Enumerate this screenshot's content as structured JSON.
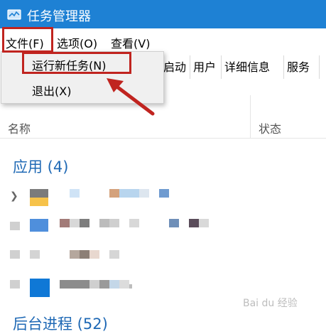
{
  "window": {
    "title": "任务管理器"
  },
  "menubar": {
    "file": "文件(F)",
    "options": "选项(O)",
    "view": "查看(V)"
  },
  "dropdown": {
    "items": [
      {
        "label": "运行新任务(N)"
      },
      {
        "label": "退出(X)"
      }
    ]
  },
  "tabs": [
    "启动",
    "用户",
    "详细信息",
    "服务"
  ],
  "table": {
    "columns": {
      "name": "名称",
      "status": "状态"
    }
  },
  "sections": {
    "apps": "应用 (4)",
    "background": "后台进程 (52)"
  },
  "watermark": "Bai du 经验",
  "colors": {
    "titlebar": "#1e81d4",
    "highlight": "#c0241f",
    "section": "#1f69b5"
  },
  "icons": {
    "app": "task-manager-icon",
    "expander": "chevron-right-icon",
    "annotation": "red-arrow-icon"
  }
}
